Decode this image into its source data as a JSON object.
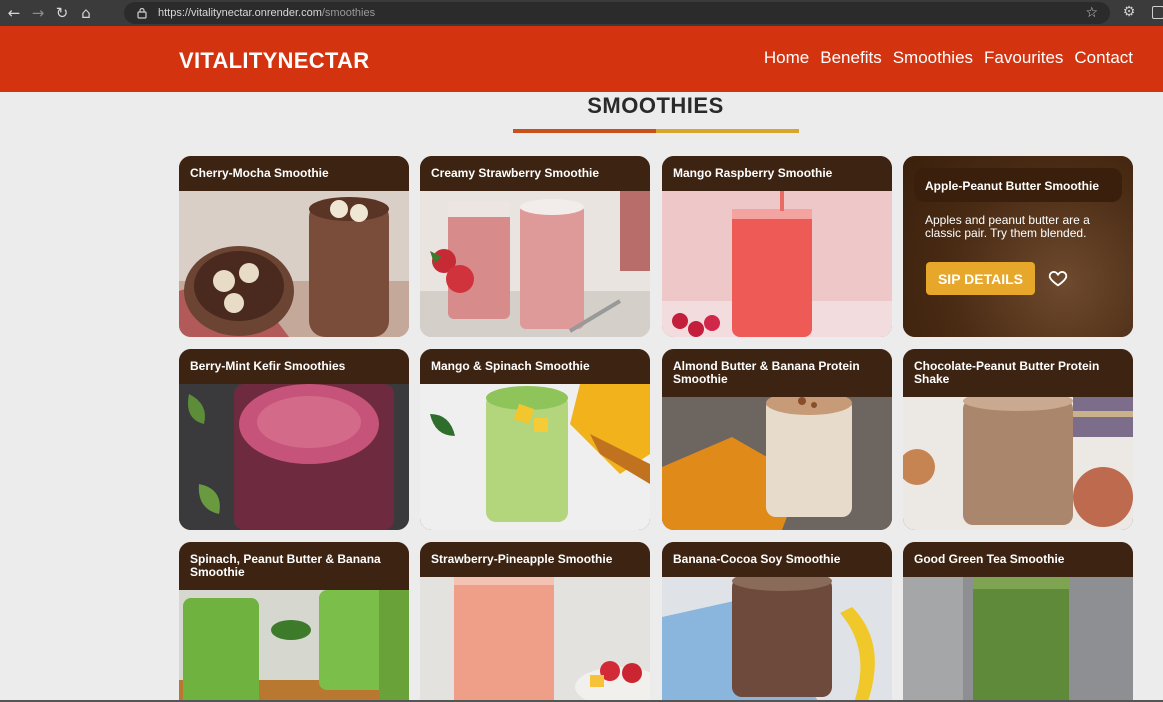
{
  "browser": {
    "url_host": "https://vitalitynectar.onrender.com",
    "url_path": "/smoothies"
  },
  "header": {
    "logo_part1": "VITALITY",
    "logo_part2": "NECTAR",
    "nav": [
      "Home",
      "Benefits",
      "Smoothies",
      "Favourites",
      "Contact"
    ]
  },
  "section": {
    "title": "SMOOTHIES"
  },
  "cards": [
    {
      "title": "Cherry-Mocha Smoothie"
    },
    {
      "title": "Creamy Strawberry Smoothie"
    },
    {
      "title": "Mango Raspberry Smoothie"
    },
    {
      "title": "Apple-Peanut Butter Smoothie",
      "description": "Apples and peanut butter are a classic pair. Try them blended.",
      "button": "SIP DETAILS"
    },
    {
      "title": "Berry-Mint Kefir Smoothies"
    },
    {
      "title": "Mango & Spinach Smoothie"
    },
    {
      "title": "Almond Butter & Banana Protein Smoothie"
    },
    {
      "title": "Chocolate-Peanut Butter Protein Shake"
    },
    {
      "title": "Spinach, Peanut Butter & Banana Smoothie"
    },
    {
      "title": "Strawberry-Pineapple Smoothie"
    },
    {
      "title": "Banana-Cocoa Soy Smoothie"
    },
    {
      "title": "Good Green Tea Smoothie"
    }
  ],
  "colors": {
    "header_bg": "#d4330f",
    "card_header_bg": "#3d2412",
    "button_bg": "#e7a72a"
  }
}
